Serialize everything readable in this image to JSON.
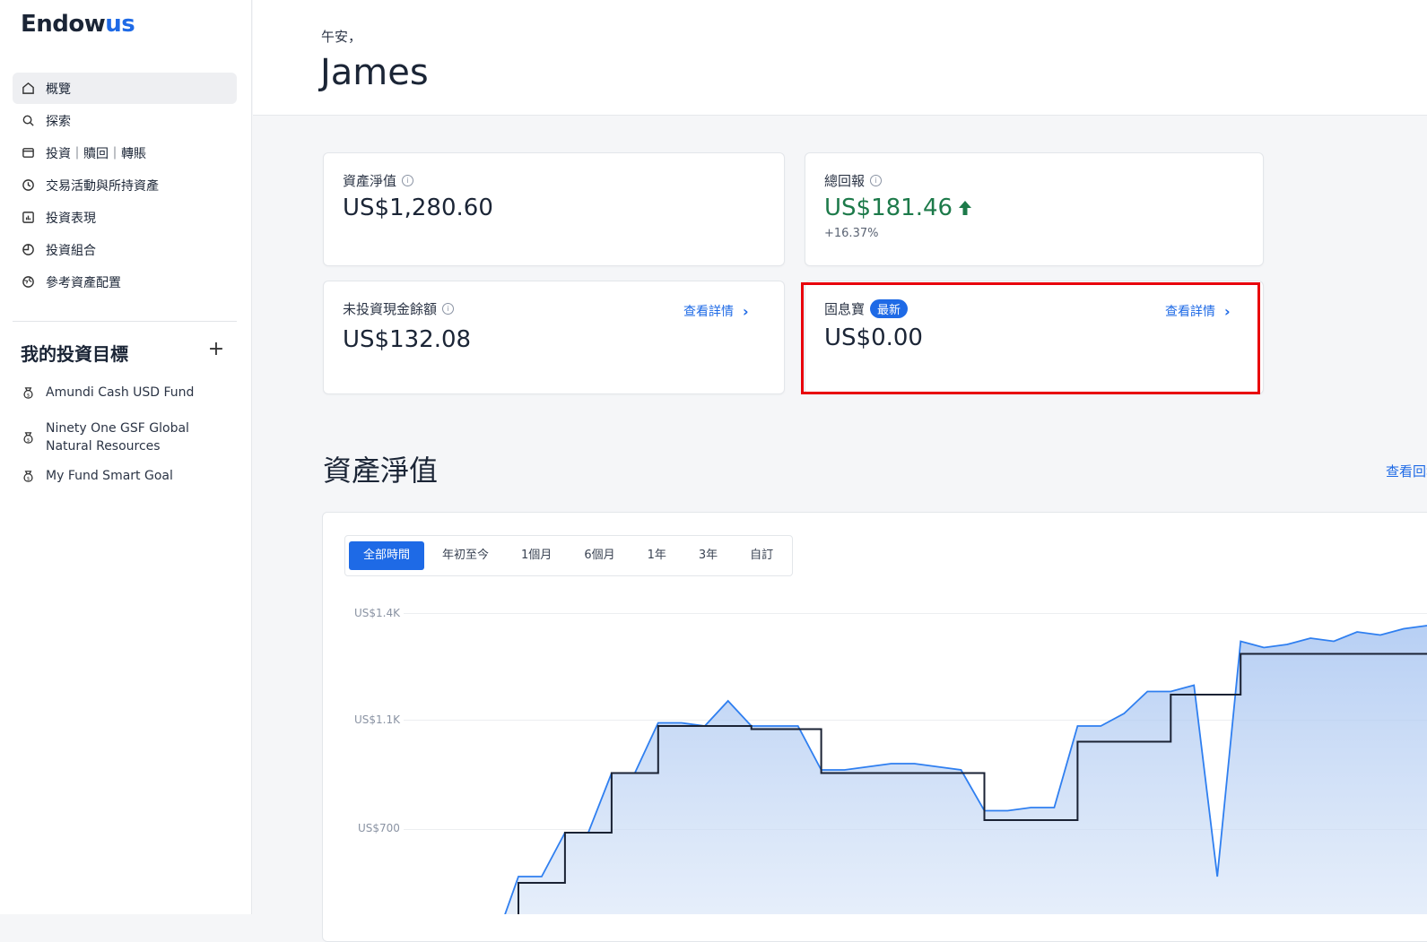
{
  "brand": {
    "logo_main": "Endow",
    "logo_accent": "us"
  },
  "sidebar": {
    "nav": [
      {
        "label": "概覽",
        "icon": "home-icon",
        "active": true
      },
      {
        "label": "探索",
        "icon": "search-icon"
      },
      {
        "label": "投資｜贖回｜轉賬",
        "icon": "wallet-icon"
      },
      {
        "label": "交易活動與所持資產",
        "icon": "clock-icon"
      },
      {
        "label": "投資表現",
        "icon": "bar-chart-icon"
      },
      {
        "label": "投資組合",
        "icon": "pie-chart-icon"
      },
      {
        "label": "參考資產配置",
        "icon": "globe-icon"
      }
    ],
    "goals_title": "我的投資目標",
    "add_label": "+",
    "goals": [
      {
        "label": "Amundi Cash USD Fund",
        "icon": "money-bag-icon"
      },
      {
        "label": "Ninety One GSF Global Natural Resources",
        "icon": "money-bag-icon"
      },
      {
        "label": "My Fund Smart Goal",
        "icon": "money-bag-icon"
      }
    ]
  },
  "header": {
    "greeting": "午安，",
    "name": "James"
  },
  "cards": {
    "net_worth": {
      "label": "資產淨值",
      "value": "US$1,280.60"
    },
    "total_return": {
      "label": "總回報",
      "value": "US$181.46",
      "percent": "+16.37%"
    },
    "cash": {
      "label": "未投資現金餘額",
      "value": "US$132.08",
      "link": "查看詳情"
    },
    "fixed": {
      "label": "固息寶",
      "badge": "最新",
      "value": "US$0.00",
      "link": "查看詳情"
    }
  },
  "section": {
    "title": "資產淨值",
    "link": "查看回報"
  },
  "chart_tabs": [
    "全部時間",
    "年初至今",
    "1個月",
    "6個月",
    "1年",
    "3年",
    "自訂"
  ],
  "chart_tab_active": "全部時間",
  "chart_data": {
    "type": "area",
    "y_ticks": [
      "US$1.4K",
      "US$1.1K",
      "US$700"
    ],
    "ylim": [
      400,
      1400
    ],
    "series": [
      {
        "values": [
          310,
          310,
          520,
          520,
          660,
          660,
          850,
          850,
          1010,
          1010,
          1000,
          1080,
          1000,
          1000,
          1000,
          860,
          860,
          870,
          880,
          880,
          870,
          860,
          730,
          730,
          740,
          740,
          1000,
          1000,
          1040,
          1110,
          1110,
          1130,
          520,
          1270,
          1250,
          1260,
          1280,
          1270,
          1300,
          1290,
          1310,
          1320
        ]
      },
      {
        "values": [
          310,
          310,
          500,
          500,
          660,
          660,
          850,
          850,
          1000,
          1000,
          1000,
          1000,
          990,
          990,
          990,
          850,
          850,
          850,
          850,
          850,
          850,
          850,
          700,
          700,
          700,
          700,
          950,
          950,
          950,
          950,
          1100,
          1100,
          1100,
          1230,
          1230,
          1230,
          1230,
          1230,
          1230,
          1230,
          1230,
          1230
        ]
      }
    ]
  }
}
